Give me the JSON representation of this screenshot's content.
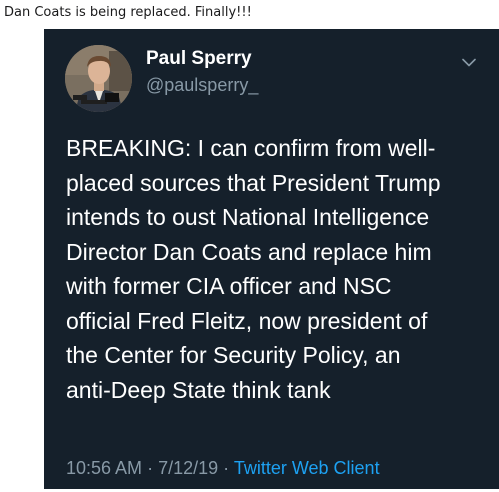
{
  "post": {
    "caption": "Dan Coats is being replaced. Finally!!!"
  },
  "tweet": {
    "author": {
      "name": "Paul Sperry",
      "handle": "@paulsperry_"
    },
    "avatar_icon": "person-photo",
    "menu_icon": "chevron-down-icon",
    "text": "BREAKING: I can confirm from well-\nplaced sources that President Trump\nintends to oust National Intelligence\nDirector Dan Coats and replace him\nwith former CIA officer and NSC\nofficial Fred Fleitz, now president of\nthe Center for Security Policy, an\nanti-Deep State think tank",
    "time": "10:56 AM",
    "separator": "·",
    "date": "7/12/19",
    "source": "Twitter Web Client"
  },
  "colors": {
    "tweet_background": "#15202b",
    "text_primary": "#ffffff",
    "text_secondary": "#8899a6",
    "link_accent": "#1da1f2"
  }
}
